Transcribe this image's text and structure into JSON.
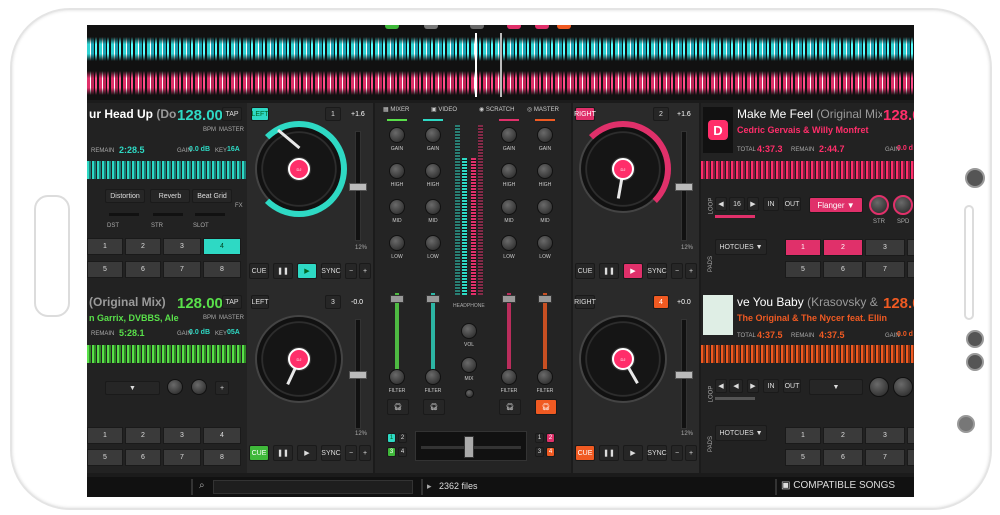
{
  "deck1": {
    "title": "ur Head Up",
    "title_extra": "(Don Di",
    "bpm": "128.00",
    "bpm_label": "BPM",
    "master_label": "MASTER",
    "tap": "TAP",
    "remain_label": "REMAIN",
    "remain": "2:28.5",
    "gain_label": "GAIN",
    "gain": "0.0 dB",
    "key_label": "KEY",
    "key": "16A",
    "fx": [
      "Distortion",
      "Reverb",
      "Beat Grid"
    ],
    "fx_labels": [
      "DST",
      "STR",
      "SLOT"
    ],
    "fx_side": "FX",
    "pads": [
      "1",
      "2",
      "3",
      "4",
      "5",
      "6",
      "7",
      "8"
    ],
    "side": "LEFT",
    "deck_num": "1",
    "pitch": "+1.6",
    "pitch_pct": "12%",
    "cue": "CUE",
    "sync": "SYNC"
  },
  "deck3": {
    "title": "(Original Mix)",
    "bpm": "128.00",
    "bpm_label": "BPM",
    "master_label": "MASTER",
    "tap": "TAP",
    "artist": "n Garrix, DVBBS, Alec",
    "remain_label": "REMAIN",
    "remain": "5:28.1",
    "gain_label": "GAIN",
    "gain": "0.0 dB",
    "key_label": "KEY",
    "key": "05A",
    "pads": [
      "1",
      "2",
      "3",
      "4",
      "5",
      "6",
      "7",
      "8"
    ],
    "side": "LEFT",
    "deck_num": "3",
    "pitch": "-0.0",
    "pitch_pct": "12%",
    "cue": "CUE",
    "sync": "SYNC"
  },
  "deck2": {
    "title": "Make Me Feel",
    "title_extra": "(Original Mix)",
    "bpm": "128.0",
    "artist": "Cedric Gervais & Willy Monfret",
    "total_label": "TOTAL",
    "total": "4:37.3",
    "remain_label": "REMAIN",
    "remain": "2:44.7",
    "gain_label": "GAIN",
    "gain": "0.0 d",
    "loop_label": "LOOP",
    "loop_val": "16",
    "in": "IN",
    "out": "OUT",
    "effect": "Flanger",
    "effect_knobs": [
      "STR",
      "SPD"
    ],
    "pads_label": "PADS",
    "hotcues": "HOTCUES",
    "pads": [
      "1",
      "2",
      "3",
      "4",
      "5",
      "6",
      "7",
      "8"
    ],
    "side": "RIGHT",
    "deck_num": "2",
    "pitch": "+1.6",
    "pitch_pct": "12%",
    "cue": "CUE",
    "sync": "SYNC"
  },
  "deck4": {
    "title": "ve You Baby",
    "title_extra": "(Krasovsky & D-R",
    "bpm": "128.0",
    "artist": "The Original & The Nycer feat. Ellin",
    "total_label": "TOTAL",
    "total": "4:37.5",
    "remain_label": "REMAIN",
    "remain": "4:37.5",
    "gain_label": "GAIN",
    "gain": "0.0 d",
    "loop_label": "LOOP",
    "in": "IN",
    "out": "OUT",
    "pads_label": "PADS",
    "hotcues": "HOTCUES",
    "pads": [
      "1",
      "2",
      "3",
      "4",
      "5",
      "6",
      "7",
      "8"
    ],
    "side": "RIGHT",
    "deck_num": "4",
    "pitch": "+0.0",
    "pitch_pct": "12%",
    "cue": "CUE",
    "sync": "SYNC"
  },
  "mixer": {
    "tabs": [
      "MIXER",
      "VIDEO",
      "SCRATCH",
      "MASTER"
    ],
    "knob_labels": [
      "GAIN",
      "HIGH",
      "MID",
      "LOW"
    ],
    "filter": "FILTER",
    "headphone": "HEADPHONE",
    "vol": "VOL",
    "mix": "MIX",
    "deck_assign_left": [
      "1",
      "3"
    ],
    "deck_assign_right": [
      "2",
      "4"
    ]
  },
  "footer": {
    "files": "2362 files",
    "compatible": "COMPATIBLE SONGS"
  },
  "colors": {
    "cyan": "#2ed9c4",
    "pink": "#e0306a",
    "green": "#59e04a",
    "orange": "#f05a22"
  }
}
